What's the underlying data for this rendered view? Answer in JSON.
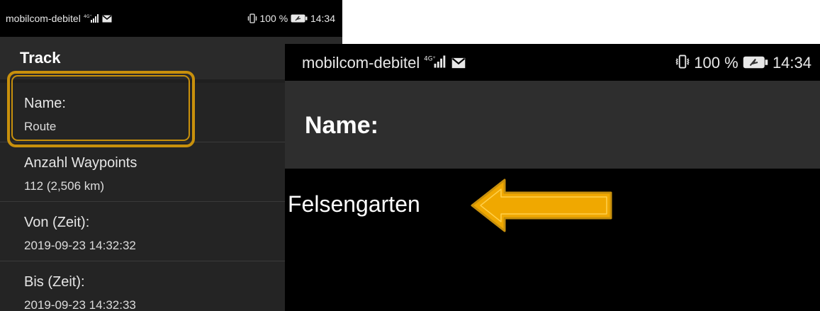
{
  "left": {
    "statusbar": {
      "carrier": "mobilcom-debitel",
      "network": "4G⁺",
      "battery": "100 %",
      "time": "14:34"
    },
    "appbar_title": "Track",
    "items": [
      {
        "label": "Name:",
        "value": "Route"
      },
      {
        "label": "Anzahl Waypoints",
        "value": "112 (2,506 km)"
      },
      {
        "label": "Von (Zeit):",
        "value": "2019-09-23 14:32:32"
      },
      {
        "label": "Bis (Zeit):",
        "value": "2019-09-23 14:32:33"
      }
    ]
  },
  "right": {
    "statusbar": {
      "carrier": "mobilcom-debitel",
      "network": "4G⁺",
      "battery": "100 %",
      "time": "14:34"
    },
    "dialog_title": "Name:",
    "field_value": "Felsengarten"
  },
  "colors": {
    "highlight": "#c8900c",
    "arrow_fill": "#f0a800",
    "arrow_outline": "#c8900c"
  },
  "icons": [
    "signal-icon",
    "mail-icon",
    "vibrate-icon",
    "battery-icon",
    "arrow-left-icon"
  ]
}
